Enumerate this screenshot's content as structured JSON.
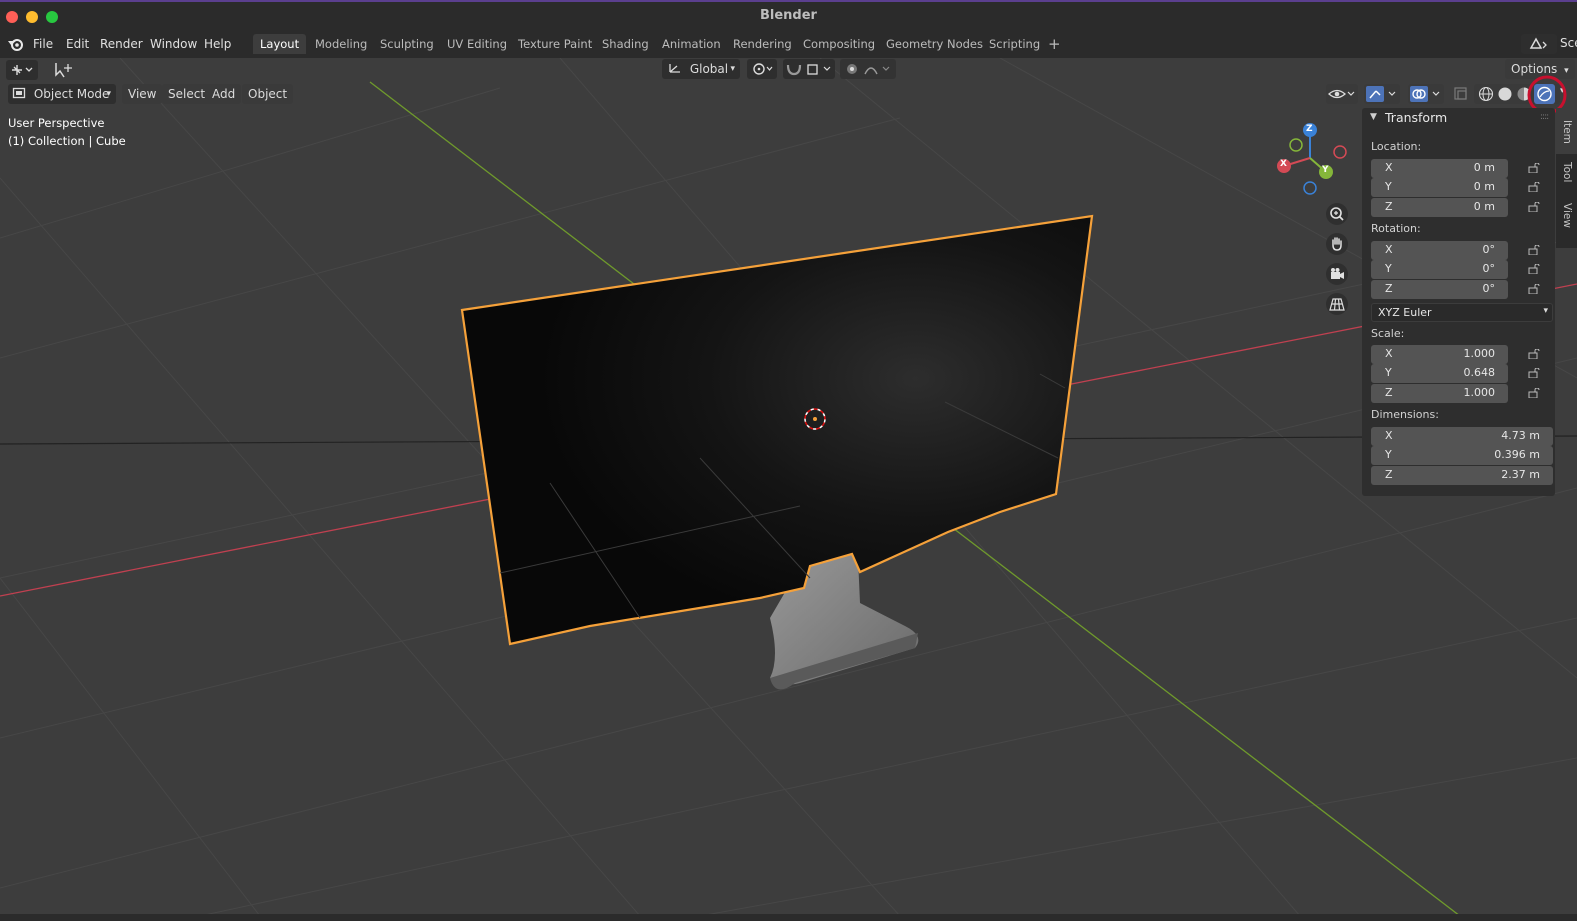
{
  "window": {
    "title": "Blender"
  },
  "menu": {
    "file": "File",
    "edit": "Edit",
    "render": "Render",
    "window": "Window",
    "help": "Help"
  },
  "workspaces": [
    "Layout",
    "Modeling",
    "Sculpting",
    "UV Editing",
    "Texture Paint",
    "Shading",
    "Animation",
    "Rendering",
    "Compositing",
    "Geometry Nodes",
    "Scripting"
  ],
  "scene_label": "Sce",
  "toolbar": {
    "orientation": "Global",
    "options": "Options"
  },
  "header": {
    "mode": "Object Mode",
    "view": "View",
    "select": "Select",
    "add": "Add",
    "object": "Object"
  },
  "viewport": {
    "perspective": "User Perspective",
    "collection": "(1) Collection | Cube"
  },
  "gizmo": {
    "x": "X",
    "y": "Y",
    "z": "Z"
  },
  "panel": {
    "title": "Transform",
    "location_label": "Location:",
    "location": [
      {
        "axis": "X",
        "value": "0 m"
      },
      {
        "axis": "Y",
        "value": "0 m"
      },
      {
        "axis": "Z",
        "value": "0 m"
      }
    ],
    "rotation_label": "Rotation:",
    "rotation": [
      {
        "axis": "X",
        "value": "0°"
      },
      {
        "axis": "Y",
        "value": "0°"
      },
      {
        "axis": "Z",
        "value": "0°"
      }
    ],
    "rotation_mode": "XYZ Euler",
    "scale_label": "Scale:",
    "scale": [
      {
        "axis": "X",
        "value": "1.000"
      },
      {
        "axis": "Y",
        "value": "0.648"
      },
      {
        "axis": "Z",
        "value": "1.000"
      }
    ],
    "dimensions_label": "Dimensions:",
    "dimensions": [
      {
        "axis": "X",
        "value": "4.73 m"
      },
      {
        "axis": "Y",
        "value": "0.396 m"
      },
      {
        "axis": "Z",
        "value": "2.37 m"
      }
    ]
  },
  "side_tabs": {
    "item": "Item",
    "tool": "Tool",
    "view": "View"
  },
  "colors": {
    "selection_outline": "#f5a13a",
    "x_axis": "#d44a55",
    "y_axis": "#85b63a",
    "z_axis": "#3a82d8",
    "active_tab": "#3d3d3d",
    "annotation_circle": "#c8102e"
  }
}
